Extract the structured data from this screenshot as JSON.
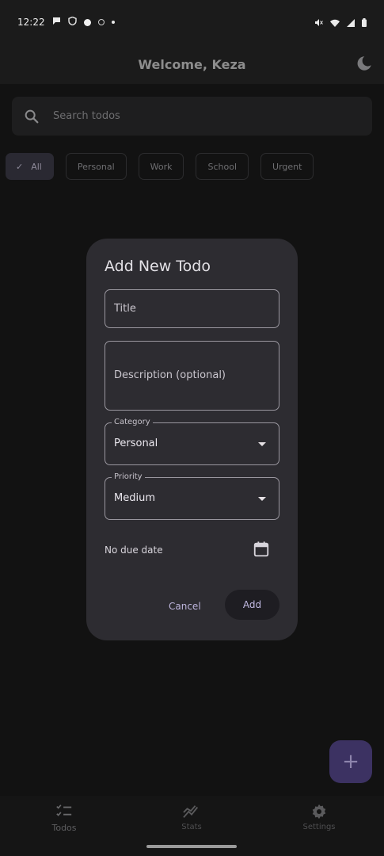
{
  "status_bar": {
    "time": "12:22",
    "left_icons": [
      "chat-bubble-icon",
      "shield-icon",
      "circle-dot-icon",
      "ring-icon",
      "small-dot-icon"
    ],
    "right_icons": [
      "mute-icon",
      "wifi-icon",
      "signal-icon",
      "battery-icon"
    ]
  },
  "app_bar": {
    "title": "Welcome, Keza",
    "theme_icon": "moon-icon"
  },
  "search": {
    "placeholder": "Search todos",
    "icon": "search-icon"
  },
  "filters": {
    "chips": [
      {
        "label": "All",
        "selected": true
      },
      {
        "label": "Personal",
        "selected": false
      },
      {
        "label": "Work",
        "selected": false
      },
      {
        "label": "School",
        "selected": false
      },
      {
        "label": "Urgent",
        "selected": false
      }
    ]
  },
  "dialog": {
    "title": "Add New Todo",
    "title_placeholder": "Title",
    "description_placeholder": "Description (optional)",
    "category": {
      "label": "Category",
      "value": "Personal"
    },
    "priority": {
      "label": "Priority",
      "value": "Medium"
    },
    "due_date_text": "No due date",
    "cancel_label": "Cancel",
    "add_label": "Add"
  },
  "fab": {
    "icon": "plus-icon"
  },
  "bottom_nav": {
    "items": [
      {
        "label": "Todos",
        "icon": "checklist-icon"
      },
      {
        "label": "Stats",
        "icon": "trending-icon"
      },
      {
        "label": "Settings",
        "icon": "gear-icon"
      }
    ]
  },
  "colors": {
    "background": "#121212",
    "dialog": "#2d2c31",
    "accent": "#3c3262"
  }
}
